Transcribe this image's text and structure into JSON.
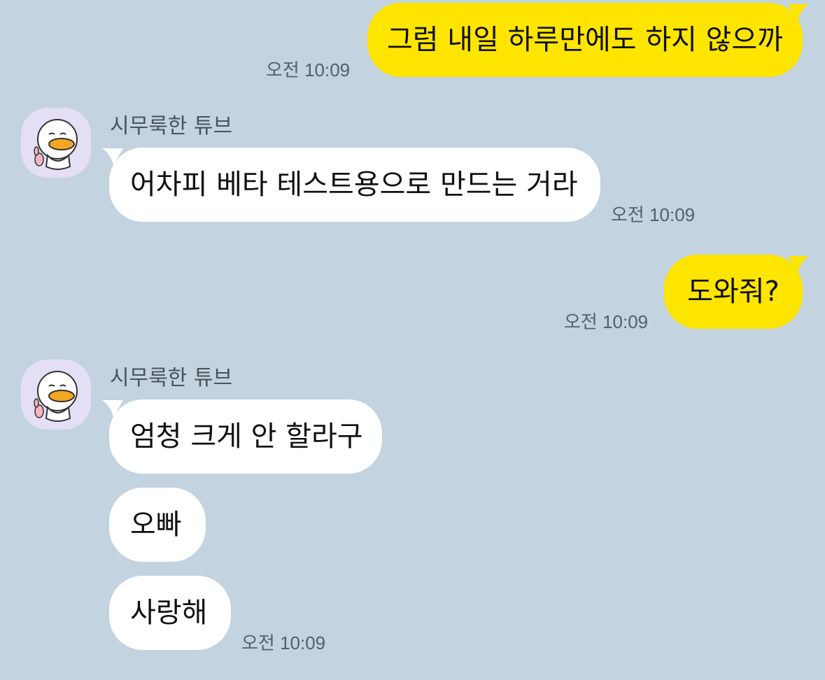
{
  "chat": {
    "messages": [
      {
        "from": "me",
        "text": "그럼 내일 하루만에도 하지 않으까",
        "time": "오전 10:09"
      },
      {
        "from": "them",
        "sender": "시무룩한 튜브",
        "text": "어차피 베타 테스트용으로 만드는 거라",
        "time": "오전 10:09"
      },
      {
        "from": "me",
        "text": "도와줘?",
        "time": "오전 10:09"
      },
      {
        "from": "them",
        "sender": "시무룩한 튜브",
        "text": "엄청 크게 안 할라구"
      },
      {
        "from": "them",
        "text": "오빠"
      },
      {
        "from": "them",
        "text": "사랑해",
        "time": "오전 10:09"
      }
    ]
  },
  "colors": {
    "background": "#c3d3df",
    "my_bubble": "#fee500",
    "their_bubble": "#ffffff",
    "avatar_bg": "#e4dff5",
    "duck_beak": "#f5a623"
  },
  "icons": {
    "avatar": "duck-character-avatar-icon"
  }
}
